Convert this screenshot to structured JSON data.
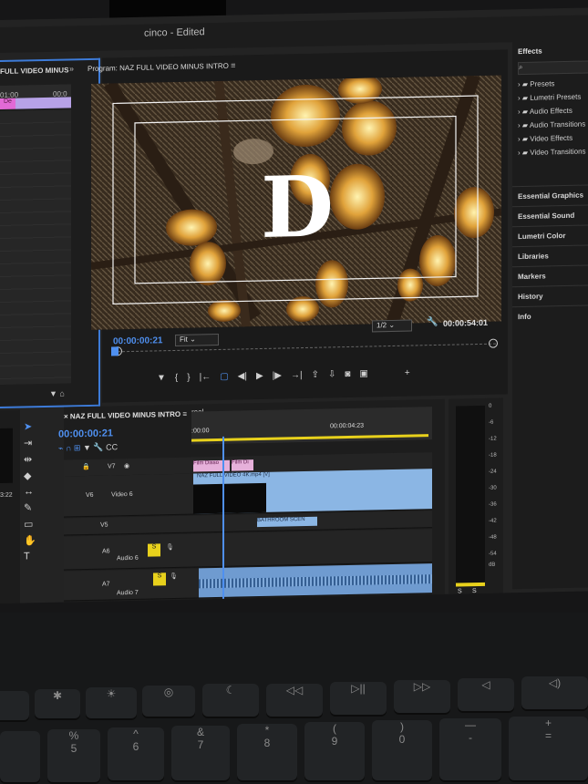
{
  "app": {
    "title": "cinco - Edited"
  },
  "source_panel": {
    "title": "FULL VIDEO MINUS",
    "ruler_left": "01:00",
    "ruler_right": "00:0",
    "clip_label": "De"
  },
  "program": {
    "title": "Program: NAZ FULL VIDEO MINUS INTRO",
    "timecode": "00:00:00:21",
    "duration": "00:00:54:01",
    "fit": "Fit",
    "resolution": "1/2",
    "overlay_letter": "D"
  },
  "effects": {
    "title": "Effects",
    "items": [
      "Presets",
      "Lumetri Presets",
      "Audio Effects",
      "Audio Transitions",
      "Video Effects",
      "Video Transitions"
    ],
    "sections": [
      "Essential Graphics",
      "Essential Sound",
      "Lumetri Color",
      "Libraries",
      "Markers",
      "History",
      "Info"
    ]
  },
  "timeline": {
    "title": "NAZ FULL VIDEO MINUS INTRO",
    "timecode": "00:00:00:21",
    "ruler_start": ":00:00",
    "ruler_mid": "00:00:04:23",
    "panel_tag": "reel",
    "tracks": [
      {
        "id": "V7",
        "name": ""
      },
      {
        "id": "V6",
        "name": "Video 6"
      },
      {
        "id": "V5",
        "name": ""
      },
      {
        "id": "A6",
        "name": "Audio 6"
      },
      {
        "id": "A7",
        "name": "Audio 7"
      }
    ],
    "clips": [
      "Film Disso",
      "Film Di",
      "NAZ FULL VIDEO 4K.mp4 [V]",
      "BATHROOM SCEN"
    ]
  },
  "left_tc": "3:22",
  "meter": {
    "scale": [
      "0",
      "-6",
      "-12",
      "-18",
      "-24",
      "-30",
      "-36",
      "-42",
      "-48",
      "-54",
      "dB"
    ],
    "solo": [
      "S",
      "S"
    ]
  },
  "colors": {
    "accent": "#4f90f0",
    "panel": "#1e1e1e",
    "clip_blue": "#8bb6e4",
    "clip_pink": "#e26ad6",
    "mute_yellow": "#e8d11c"
  },
  "keyboard": {
    "keys": [
      "✱",
      "☀",
      "◎",
      "☾",
      "◁◁",
      "▷||",
      "▷▷",
      "◁",
      "◁)",
      "◁))"
    ],
    "row2": [
      "%",
      "^",
      "&",
      "*",
      "(",
      ")",
      "—",
      "+"
    ],
    "row2_low": [
      "5",
      "6",
      "7",
      "8",
      "9",
      "0",
      "-",
      "="
    ]
  }
}
